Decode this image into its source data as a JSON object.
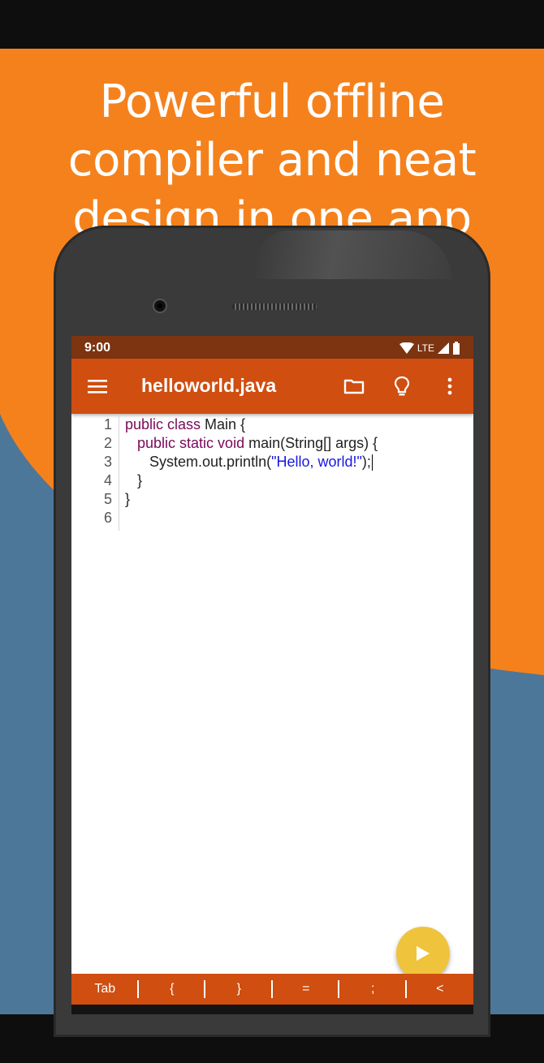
{
  "promo": {
    "headline": [
      "Powerful offline",
      "compiler and neat",
      "design in one app"
    ],
    "colors": {
      "orange": "#f5811c",
      "blue": "#4c7799"
    }
  },
  "status_bar": {
    "time": "9:00",
    "network": "LTE",
    "icons": [
      "wifi-icon",
      "cell-signal-icon",
      "battery-icon"
    ]
  },
  "appbar": {
    "title": "helloworld.java",
    "icons": [
      "menu-icon",
      "folder-icon",
      "lightbulb-icon",
      "more-vert-icon"
    ],
    "color": "#cf4e10"
  },
  "editor": {
    "line_numbers": [
      "1",
      "2",
      "3",
      "4",
      "5",
      "6"
    ],
    "lines": [
      {
        "indent": "",
        "kw": "public class",
        "text": " Main {",
        "str": "",
        "tail": ""
      },
      {
        "indent": "   ",
        "kw": "public static void",
        "text": " main(String[] args) {",
        "str": "",
        "tail": ""
      },
      {
        "indent": "      ",
        "kw": "",
        "text": "System.out.println(",
        "str": "\"Hello, world!\"",
        "tail": ");"
      },
      {
        "indent": "   ",
        "kw": "",
        "text": "}",
        "str": "",
        "tail": ""
      },
      {
        "indent": "",
        "kw": "",
        "text": "}",
        "str": "",
        "tail": ""
      },
      {
        "indent": "",
        "kw": "",
        "text": "",
        "str": "",
        "tail": ""
      }
    ]
  },
  "run_button": {
    "icon": "play-icon",
    "color": "#f0c33c"
  },
  "symbol_keys": [
    "Tab",
    "{",
    "}",
    "=",
    ";",
    "<"
  ]
}
